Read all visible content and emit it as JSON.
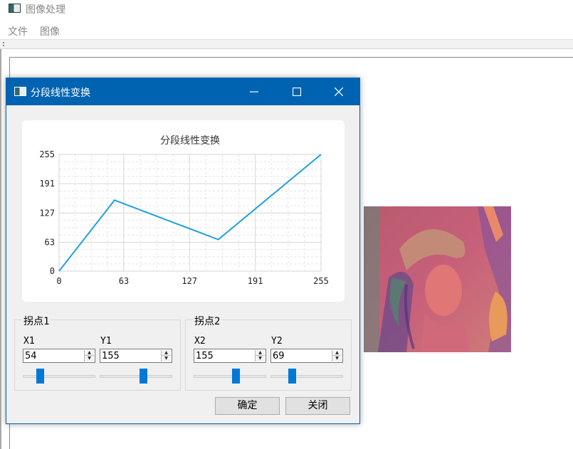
{
  "app": {
    "title": "图像处理",
    "menu": [
      "文件",
      "图像"
    ]
  },
  "dialog": {
    "title": "分段线性变换",
    "buttons": {
      "ok": "确定",
      "close": "关闭"
    }
  },
  "groups": [
    {
      "title": "拐点1",
      "x_label": "X1",
      "y_label": "Y1",
      "x_value": "54",
      "y_value": "155",
      "x_slider": 0.21,
      "y_slider": 0.61
    },
    {
      "title": "拐点2",
      "x_label": "X2",
      "y_label": "Y2",
      "x_value": "155",
      "y_value": "69",
      "x_slider": 0.59,
      "y_slider": 0.27
    }
  ],
  "colors": {
    "accent": "#0063b1",
    "line": "#209fdf",
    "slider": "#0078d7"
  },
  "chart_data": {
    "type": "line",
    "title": "分段线性变换",
    "xlim": [
      0,
      255
    ],
    "ylim": [
      0,
      255
    ],
    "x_ticks": [
      "0",
      "63",
      "127",
      "191",
      "255"
    ],
    "y_ticks": [
      "0",
      "63",
      "127",
      "191",
      "255"
    ],
    "grid": true,
    "series": [
      {
        "x": [
          0,
          54,
          155,
          255
        ],
        "y": [
          0,
          155,
          69,
          255
        ]
      }
    ]
  }
}
